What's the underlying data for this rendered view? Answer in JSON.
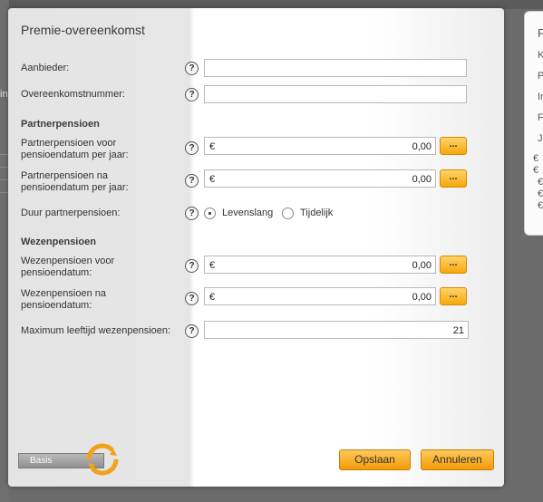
{
  "dialog": {
    "title": "Premie-overeenkomst",
    "fields": {
      "aanbieder": {
        "label": "Aanbieder:",
        "value": ""
      },
      "overeenkomstnummer": {
        "label": "Overeenkomstnummer:",
        "value": ""
      }
    },
    "partnerpensioen": {
      "section": "Partnerpensioen",
      "voor": {
        "label1": "Partnerpensioen voor",
        "label2": "pensioendatum per jaar:",
        "currency": "€",
        "value": "0,00"
      },
      "na": {
        "label1": "Partnerpensioen na",
        "label2": "pensioendatum per jaar:",
        "currency": "€",
        "value": "0,00"
      },
      "duur": {
        "label": "Duur partnerpensioen:",
        "options": [
          "Levenslang",
          "Tijdelijk"
        ],
        "selected": "Levenslang"
      }
    },
    "wezenpensioen": {
      "section": "Wezenpensioen",
      "voor": {
        "label1": "Wezenpensioen voor",
        "label2": "pensioendatum:",
        "currency": "€",
        "value": "0,00"
      },
      "na": {
        "label1": "Wezenpensioen na",
        "label2": "pensioendatum:",
        "currency": "€",
        "value": "0,00"
      },
      "maxleeftijd": {
        "label": "Maximum leeftijd wezenpensioen:",
        "value": "21"
      }
    },
    "help_glyph": "?",
    "dots_label": "...",
    "footer": {
      "mode_label": "Basis",
      "save": "Opslaan",
      "cancel": "Annuleren"
    }
  },
  "background": {
    "left_fragment": "in",
    "card_fragments": [
      "F",
      "K",
      "P",
      "Ir",
      "F",
      "Ja",
      "€",
      "€",
      "€",
      "€",
      "€"
    ]
  },
  "colors": {
    "accent": "#f7a70b",
    "overlay": "#6b6b6b"
  }
}
